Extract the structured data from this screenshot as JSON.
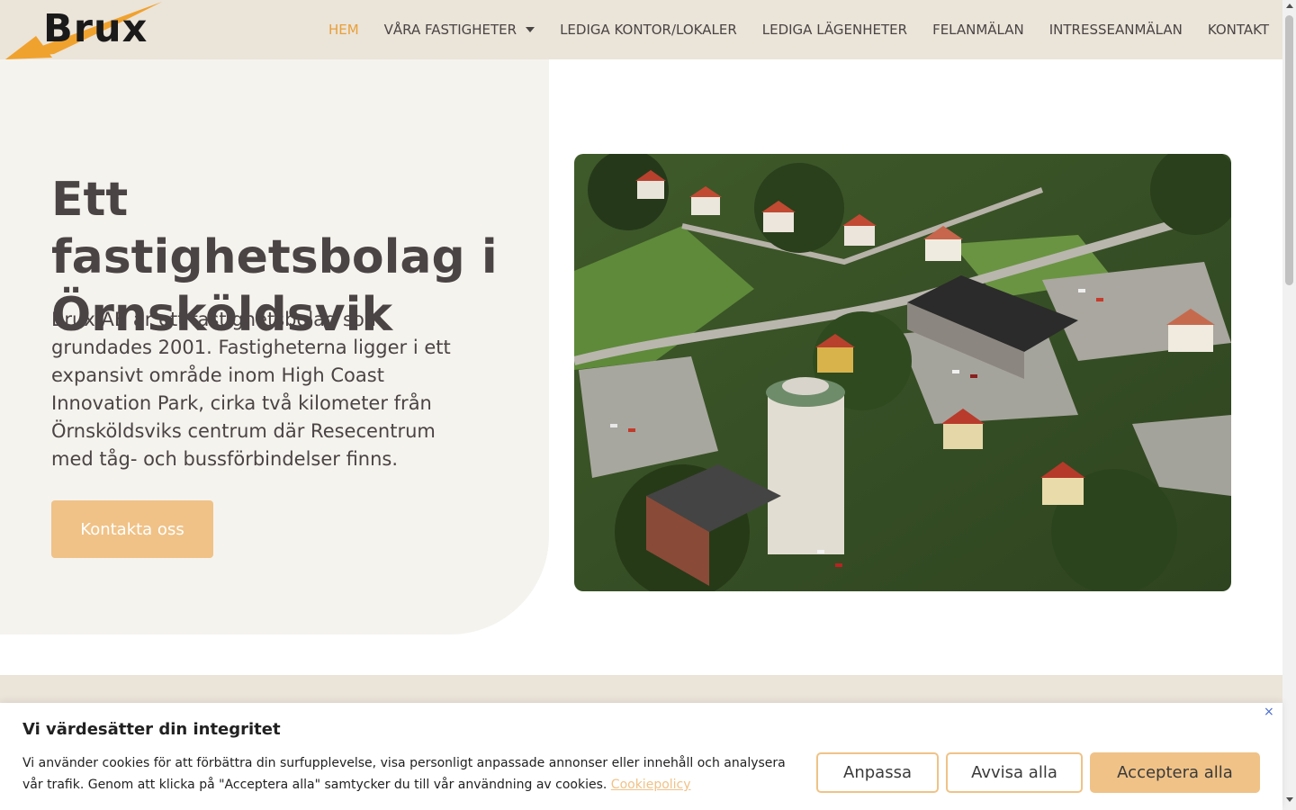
{
  "header": {
    "logo_text": "Brux",
    "nav": [
      {
        "label": "HEM",
        "active": true
      },
      {
        "label": "VÅRA FASTIGHETER",
        "has_dropdown": true
      },
      {
        "label": "LEDIGA KONTOR/LOKALER"
      },
      {
        "label": "LEDIGA LÄGENHETER"
      },
      {
        "label": "FELANMÄLAN"
      },
      {
        "label": "INTRESSEANMÄLAN"
      },
      {
        "label": "KONTAKT"
      }
    ]
  },
  "hero": {
    "title": "Ett fastighetsbolag i Örnsköldsvik",
    "text": "Brux AB är ett fastighetsbolag som grundades 2001. Fastigheterna ligger i ett expansivt område inom High Coast Innovation Park, cirka två kilometer från Örnsköldsviks centrum där Resecentrum med tåg- och bussförbindelser finns.",
    "cta_label": "Kontakta oss"
  },
  "cookie": {
    "title": "Vi värdesätter din integritet",
    "text": "Vi använder cookies för att förbättra din surfupplevelse, visa personligt anpassade annonser eller innehåll och analysera vår trafik. Genom att klicka på \"Acceptera alla\" samtycker du till vår användning av cookies.",
    "link_label": "Cookiepolicy",
    "close_label": "×",
    "customize_label": "Anpassa",
    "reject_label": "Avvisa alla",
    "accept_label": "Acceptera alla"
  },
  "colors": {
    "accent": "#e8a03a",
    "button": "#f0c287",
    "header_bg": "#ebe4d9",
    "hero_bg": "#f5f3ee",
    "text": "#4a4444"
  }
}
